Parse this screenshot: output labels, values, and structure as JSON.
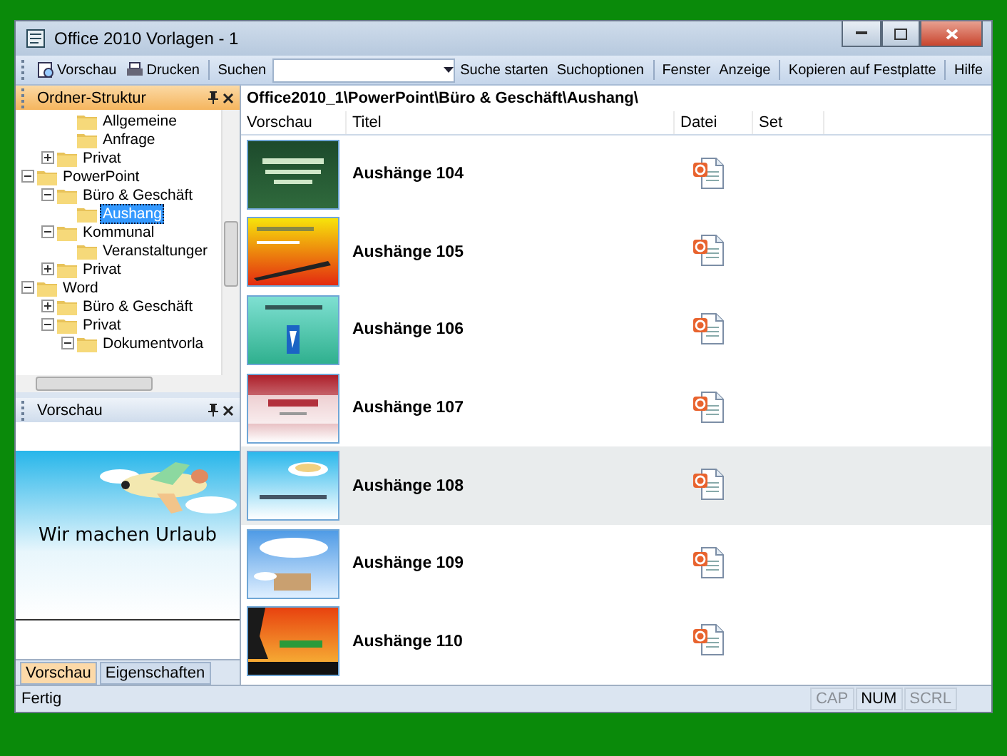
{
  "window": {
    "title": "Office 2010 Vorlagen - 1"
  },
  "toolbar": {
    "buttons": [
      {
        "kind": "icon",
        "label": "Vorschau"
      },
      {
        "kind": "icon",
        "label": "Drucken"
      }
    ],
    "search_label": "Suchen",
    "action_groups": [
      [
        "Suche starten",
        "Suchoptionen"
      ],
      [
        "Fenster",
        "Anzeige"
      ],
      [
        "Kopieren auf Festplatte"
      ],
      [
        "Hilfe"
      ]
    ]
  },
  "folder_panel": {
    "title": "Ordner-Struktur",
    "tree": [
      {
        "children": [
          {
            "children": [
              {
                "label": "Allgemeine",
                "selected": false
              },
              {
                "label": "Anfrage",
                "selected": false
              }
            ]
          },
          {
            "label": "Privat",
            "expanded": false,
            "selected": false
          }
        ]
      },
      {
        "label": "PowerPoint",
        "expanded": true,
        "selected": false,
        "children": [
          {
            "label": "Büro & Geschäft",
            "expanded": true,
            "selected": false,
            "children": [
              {
                "label": "Aushang",
                "selected": true
              }
            ]
          },
          {
            "label": "Kommunal",
            "expanded": true,
            "selected": false,
            "children": [
              {
                "label": "Veranstaltunger",
                "selected": false
              }
            ]
          },
          {
            "label": "Privat",
            "expanded": false,
            "selected": false
          }
        ]
      },
      {
        "label": "Word",
        "expanded": true,
        "selected": false,
        "children": [
          {
            "label": "Büro & Geschäft",
            "expanded": false,
            "selected": false
          },
          {
            "label": "Privat",
            "expanded": true,
            "selected": false,
            "children": [
              {
                "label": "Dokumentvorla",
                "expanded": true,
                "selected": false
              }
            ]
          }
        ]
      }
    ]
  },
  "preview_panel": {
    "title": "Vorschau",
    "slide_text": "Wir machen Urlaub"
  },
  "bottom_tabs": [
    {
      "label": "Vorschau",
      "selected": true
    },
    {
      "label": "Eigenschaften",
      "selected": false
    }
  ],
  "path": "Office2010_1\\PowerPoint\\Büro & Geschäft\\Aushang\\",
  "table": {
    "columns": [
      "Vorschau",
      "Titel",
      "Datei",
      "Set"
    ],
    "rows": [
      {
        "title": "Aushänge 104",
        "selected": false
      },
      {
        "title": "Aushänge 105",
        "selected": false
      },
      {
        "title": "Aushänge 106",
        "selected": false
      },
      {
        "title": "Aushänge 107",
        "selected": false
      },
      {
        "title": "Aushänge 108",
        "selected": true
      },
      {
        "title": "Aushänge 109",
        "selected": false
      },
      {
        "title": "Aushänge 110",
        "selected": false
      }
    ]
  },
  "status_bar": {
    "text": "Fertig",
    "indicators": [
      {
        "label": "CAP",
        "on": false
      },
      {
        "label": "NUM",
        "on": true
      },
      {
        "label": "SCRL",
        "on": false
      }
    ]
  }
}
